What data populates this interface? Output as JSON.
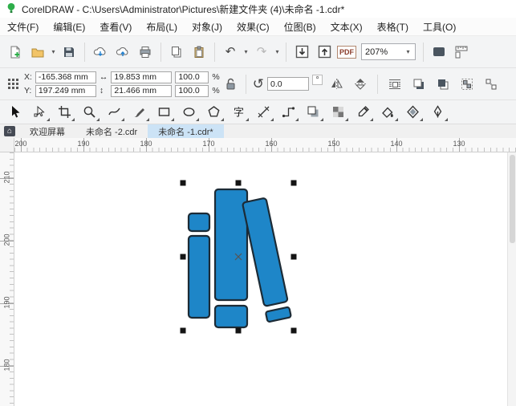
{
  "titlebar": {
    "title": "CorelDRAW - C:\\Users\\Administrator\\Pictures\\新建文件夹 (4)\\未命名 -1.cdr*"
  },
  "menu": {
    "items": [
      "文件(F)",
      "编辑(E)",
      "查看(V)",
      "布局(L)",
      "对象(J)",
      "效果(C)",
      "位图(B)",
      "文本(X)",
      "表格(T)",
      "工具(O)"
    ]
  },
  "toolbar": {
    "pdf_label": "PDF",
    "zoom_value": "207%"
  },
  "property_bar": {
    "x_label": "X:",
    "y_label": "Y:",
    "x_value": "-165.368 mm",
    "y_value": "197.249 mm",
    "width_value": "19.853 mm",
    "height_value": "21.466 mm",
    "scale_x_value": "100.0",
    "scale_y_value": "100.0",
    "percent_label": "%",
    "angle_value": "0.0",
    "degree_label": "°"
  },
  "toolbox": {
    "text_tool_glyph": "字",
    "tools": [
      "pick",
      "shape",
      "crop",
      "zoom",
      "freehand",
      "artistic-media",
      "rectangle",
      "ellipse",
      "polygon",
      "text",
      "parallel-dimension",
      "connector",
      "drop-shadow",
      "transparency",
      "color-eyedropper",
      "interactive-fill",
      "smart-fill",
      "outline-pen"
    ]
  },
  "tabs": {
    "items": [
      {
        "label": "欢迎屏幕",
        "active": false
      },
      {
        "label": "未命名 -2.cdr",
        "active": false
      },
      {
        "label": "未命名 -1.cdr*",
        "active": true
      }
    ]
  },
  "rulers": {
    "horizontal_labels": [
      "200",
      "190",
      "180",
      "170",
      "160",
      "150",
      "140",
      "130"
    ],
    "vertical_labels": [
      "210",
      "200",
      "190",
      "180"
    ]
  },
  "icons": {
    "home_glyph": "⌂",
    "undo_glyph": "↶",
    "redo_glyph": "↷",
    "caret_glyph": "▾",
    "h_arrow_glyph": "↔",
    "v_arrow_glyph": "↕",
    "rotate_glyph": "↺"
  },
  "artwork": {
    "name": "books drawing (selected)",
    "fill_color": "#1e86c8",
    "outline_color": "#1c2b36",
    "handle_color": "#141414"
  }
}
